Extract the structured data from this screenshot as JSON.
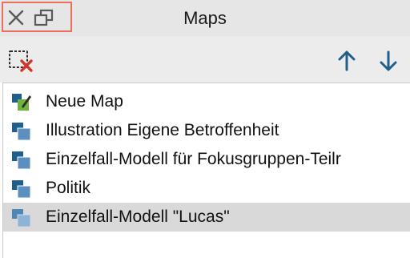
{
  "window": {
    "title": "Maps",
    "controls": [
      {
        "name": "close-icon",
        "glyph": "✕"
      },
      {
        "name": "detach-window-icon",
        "glyph": "restore"
      }
    ],
    "control_highlight_color": "#ec6f5e"
  },
  "toolbar": {
    "delete_icon": "map-delete-icon",
    "move_up_icon": "arrow-up-icon",
    "move_down_icon": "arrow-down-icon",
    "accent": "#1f5f8b",
    "delete_color": "#d2362a"
  },
  "maps": {
    "items": [
      {
        "label": "Neue Map",
        "icon": "new-map-icon",
        "selected": false
      },
      {
        "label": "Illustration Eigene Betroffenheit",
        "icon": "map-icon",
        "selected": false
      },
      {
        "label": "Einzelfall-Modell für Fokusgruppen-Teilr",
        "icon": "map-icon",
        "selected": false
      },
      {
        "label": "Politik",
        "icon": "map-icon",
        "selected": false
      },
      {
        "label": "Einzelfall-Modell \"Lucas\"",
        "icon": "map-icon",
        "selected": true
      }
    ]
  }
}
